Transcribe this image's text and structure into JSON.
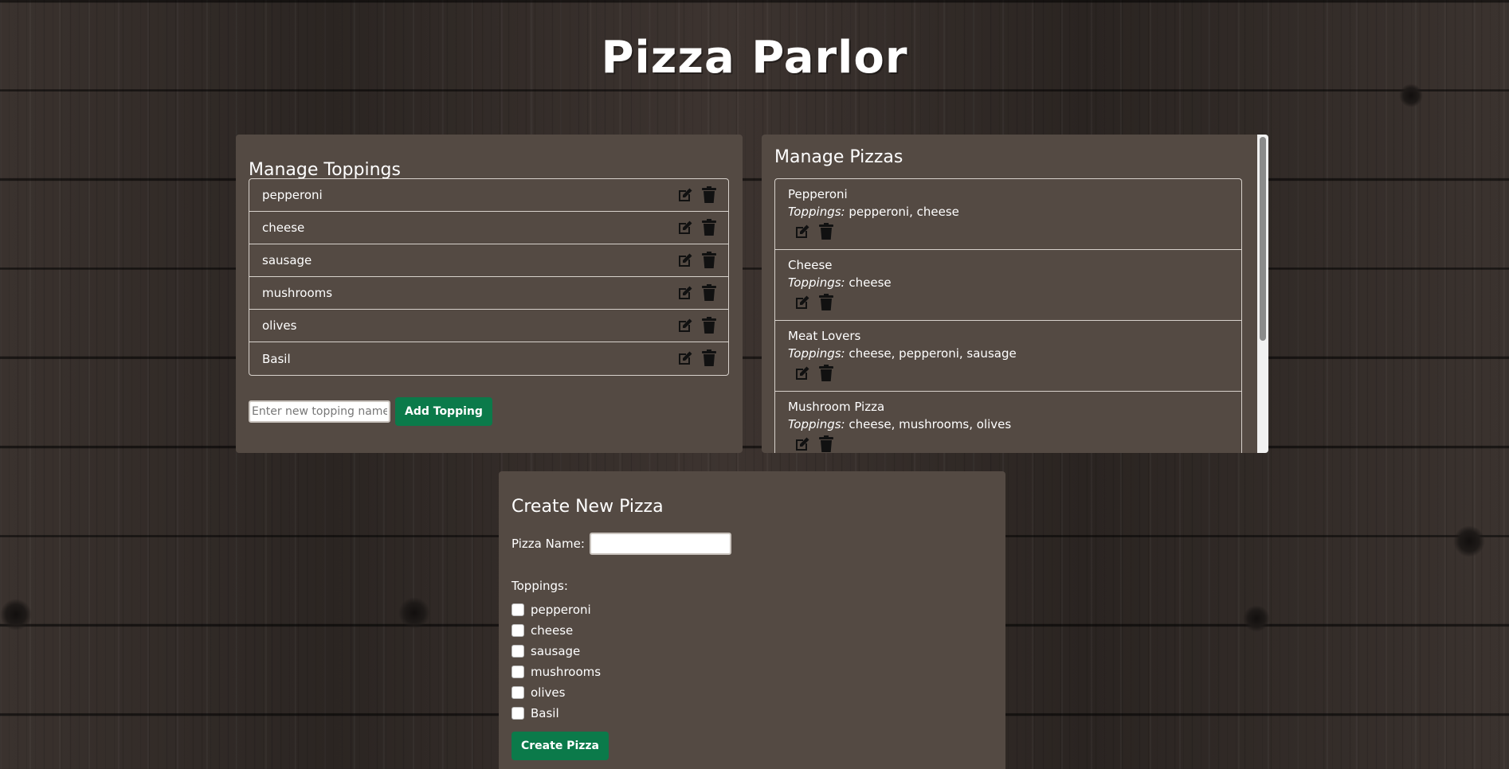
{
  "app_title": "Pizza Parlor",
  "toppings_panel": {
    "heading": "Manage Toppings",
    "items": [
      {
        "label": "pepperoni"
      },
      {
        "label": "cheese"
      },
      {
        "label": "sausage"
      },
      {
        "label": "mushrooms"
      },
      {
        "label": "olives"
      },
      {
        "label": "Basil"
      }
    ],
    "new_topping_placeholder": "Enter new topping name",
    "add_button": "Add Topping"
  },
  "pizzas_panel": {
    "heading": "Manage Pizzas",
    "toppings_prefix": "Toppings:",
    "items": [
      {
        "name": "Pepperoni",
        "toppings": "pepperoni, cheese"
      },
      {
        "name": "Cheese",
        "toppings": "cheese"
      },
      {
        "name": "Meat Lovers",
        "toppings": "cheese, pepperoni, sausage"
      },
      {
        "name": "Mushroom Pizza",
        "toppings": "cheese, mushrooms, olives"
      }
    ]
  },
  "create_panel": {
    "heading": "Create New Pizza",
    "name_label": "Pizza Name:",
    "name_value": "",
    "toppings_label": "Toppings:",
    "options": [
      {
        "label": "pepperoni",
        "checked": false
      },
      {
        "label": "cheese",
        "checked": false
      },
      {
        "label": "sausage",
        "checked": false
      },
      {
        "label": "mushrooms",
        "checked": false
      },
      {
        "label": "olives",
        "checked": false
      },
      {
        "label": "Basil",
        "checked": false
      }
    ],
    "submit_button": "Create Pizza"
  },
  "colors": {
    "panel_bg": "#544a43",
    "accent_green": "#0b7a4a",
    "text": "#ffffff"
  },
  "icons": {
    "edit": "edit-icon",
    "delete": "trash-icon"
  }
}
